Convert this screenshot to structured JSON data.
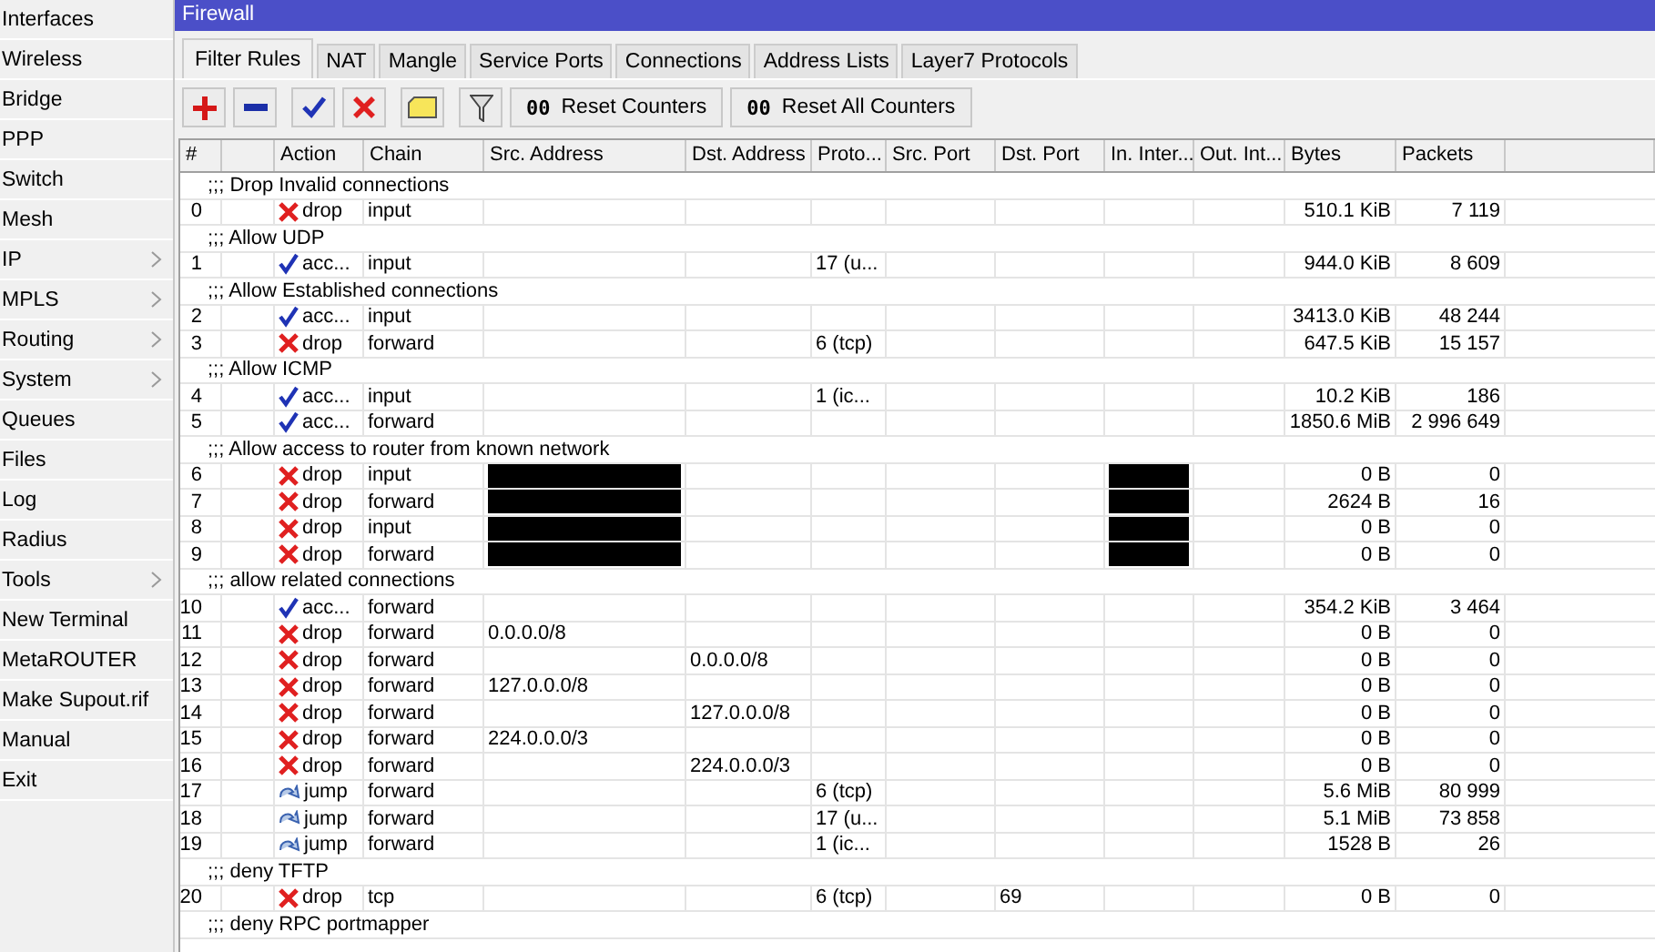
{
  "sidebar": {
    "items": [
      {
        "label": "Interfaces",
        "submenu": false
      },
      {
        "label": "Wireless",
        "submenu": false
      },
      {
        "label": "Bridge",
        "submenu": false
      },
      {
        "label": "PPP",
        "submenu": false
      },
      {
        "label": "Switch",
        "submenu": false
      },
      {
        "label": "Mesh",
        "submenu": false
      },
      {
        "label": "IP",
        "submenu": true
      },
      {
        "label": "MPLS",
        "submenu": true
      },
      {
        "label": "Routing",
        "submenu": true
      },
      {
        "label": "System",
        "submenu": true
      },
      {
        "label": "Queues",
        "submenu": false
      },
      {
        "label": "Files",
        "submenu": false
      },
      {
        "label": "Log",
        "submenu": false
      },
      {
        "label": "Radius",
        "submenu": false
      },
      {
        "label": "Tools",
        "submenu": true
      },
      {
        "label": "New Terminal",
        "submenu": false
      },
      {
        "label": "MetaROUTER",
        "submenu": false
      },
      {
        "label": "Make Supout.rif",
        "submenu": false
      },
      {
        "label": "Manual",
        "submenu": false
      },
      {
        "label": "Exit",
        "submenu": false
      }
    ]
  },
  "window": {
    "title": "Firewall"
  },
  "tabs": [
    {
      "label": "Filter Rules",
      "selected": true
    },
    {
      "label": "NAT",
      "selected": false
    },
    {
      "label": "Mangle",
      "selected": false
    },
    {
      "label": "Service Ports",
      "selected": false
    },
    {
      "label": "Connections",
      "selected": false
    },
    {
      "label": "Address Lists",
      "selected": false
    },
    {
      "label": "Layer7 Protocols",
      "selected": false
    }
  ],
  "toolbar": {
    "tools": [
      {
        "kind": "add"
      },
      {
        "kind": "remove"
      },
      {
        "kind": "enable"
      },
      {
        "kind": "disable"
      },
      {
        "kind": "comment"
      },
      {
        "kind": "filter"
      }
    ],
    "buttons": [
      {
        "icon_text": "00",
        "label": "Reset Counters"
      },
      {
        "icon_text": "00",
        "label": "Reset All Counters"
      }
    ]
  },
  "table": {
    "columns": [
      "#",
      "",
      "Action",
      "Chain",
      "Src. Address",
      "Dst. Address",
      "Proto...",
      "Src. Port",
      "Dst. Port",
      "In. Inter...",
      "Out. Int...",
      "Bytes",
      "Packets"
    ],
    "rows": [
      {
        "kind": "comment",
        "text": ";;; Drop Invalid connections"
      },
      {
        "kind": "drop",
        "num": "0",
        "action": "drop",
        "chain": "input",
        "src": "",
        "src_redacted": false,
        "dst": "",
        "proto": "",
        "src_port": "",
        "dst_port": "",
        "in_redacted": false,
        "bytes": "510.1 KiB",
        "packets": "7 119"
      },
      {
        "kind": "comment",
        "text": ";;; Allow UDP"
      },
      {
        "kind": "accept",
        "num": "1",
        "action": "acc...",
        "chain": "input",
        "src": "",
        "src_redacted": false,
        "dst": "",
        "proto": "17 (u...",
        "src_port": "",
        "dst_port": "",
        "in_redacted": false,
        "bytes": "944.0 KiB",
        "packets": "8 609"
      },
      {
        "kind": "comment",
        "text": ";;; Allow Established connections"
      },
      {
        "kind": "accept",
        "num": "2",
        "action": "acc...",
        "chain": "input",
        "src": "",
        "src_redacted": false,
        "dst": "",
        "proto": "",
        "src_port": "",
        "dst_port": "",
        "in_redacted": false,
        "bytes": "3413.0 KiB",
        "packets": "48 244"
      },
      {
        "kind": "drop",
        "num": "3",
        "action": "drop",
        "chain": "forward",
        "src": "",
        "src_redacted": false,
        "dst": "",
        "proto": "6 (tcp)",
        "src_port": "",
        "dst_port": "",
        "in_redacted": false,
        "bytes": "647.5 KiB",
        "packets": "15 157"
      },
      {
        "kind": "comment",
        "text": ";;; Allow ICMP"
      },
      {
        "kind": "accept",
        "num": "4",
        "action": "acc...",
        "chain": "input",
        "src": "",
        "src_redacted": false,
        "dst": "",
        "proto": "1 (ic...",
        "src_port": "",
        "dst_port": "",
        "in_redacted": false,
        "bytes": "10.2 KiB",
        "packets": "186"
      },
      {
        "kind": "accept",
        "num": "5",
        "action": "acc...",
        "chain": "forward",
        "src": "",
        "src_redacted": false,
        "dst": "",
        "proto": "",
        "src_port": "",
        "dst_port": "",
        "in_redacted": false,
        "bytes": "1850.6 MiB",
        "packets": "2 996 649"
      },
      {
        "kind": "comment",
        "text": ";;; Allow access to router from known network"
      },
      {
        "kind": "drop",
        "num": "6",
        "action": "drop",
        "chain": "input",
        "src": "",
        "src_redacted": true,
        "dst": "",
        "proto": "",
        "src_port": "",
        "dst_port": "",
        "in_redacted": true,
        "bytes": "0 B",
        "packets": "0"
      },
      {
        "kind": "drop",
        "num": "7",
        "action": "drop",
        "chain": "forward",
        "src": "",
        "src_redacted": true,
        "dst": "",
        "proto": "",
        "src_port": "",
        "dst_port": "",
        "in_redacted": true,
        "bytes": "2624 B",
        "packets": "16"
      },
      {
        "kind": "drop",
        "num": "8",
        "action": "drop",
        "chain": "input",
        "src": "",
        "src_redacted": true,
        "dst": "",
        "proto": "",
        "src_port": "",
        "dst_port": "",
        "in_redacted": true,
        "bytes": "0 B",
        "packets": "0"
      },
      {
        "kind": "drop",
        "num": "9",
        "action": "drop",
        "chain": "forward",
        "src": "",
        "src_redacted": true,
        "dst": "",
        "proto": "",
        "src_port": "",
        "dst_port": "",
        "in_redacted": true,
        "bytes": "0 B",
        "packets": "0"
      },
      {
        "kind": "comment",
        "text": ";;; allow related connections"
      },
      {
        "kind": "accept",
        "num": "10",
        "action": "acc...",
        "chain": "forward",
        "src": "",
        "src_redacted": false,
        "dst": "",
        "proto": "",
        "src_port": "",
        "dst_port": "",
        "in_redacted": false,
        "bytes": "354.2 KiB",
        "packets": "3 464"
      },
      {
        "kind": "drop",
        "num": "11",
        "action": "drop",
        "chain": "forward",
        "src": "0.0.0.0/8",
        "src_redacted": false,
        "dst": "",
        "proto": "",
        "src_port": "",
        "dst_port": "",
        "in_redacted": false,
        "bytes": "0 B",
        "packets": "0"
      },
      {
        "kind": "drop",
        "num": "12",
        "action": "drop",
        "chain": "forward",
        "src": "",
        "src_redacted": false,
        "dst": "0.0.0.0/8",
        "proto": "",
        "src_port": "",
        "dst_port": "",
        "in_redacted": false,
        "bytes": "0 B",
        "packets": "0"
      },
      {
        "kind": "drop",
        "num": "13",
        "action": "drop",
        "chain": "forward",
        "src": "127.0.0.0/8",
        "src_redacted": false,
        "dst": "",
        "proto": "",
        "src_port": "",
        "dst_port": "",
        "in_redacted": false,
        "bytes": "0 B",
        "packets": "0"
      },
      {
        "kind": "drop",
        "num": "14",
        "action": "drop",
        "chain": "forward",
        "src": "",
        "src_redacted": false,
        "dst": "127.0.0.0/8",
        "proto": "",
        "src_port": "",
        "dst_port": "",
        "in_redacted": false,
        "bytes": "0 B",
        "packets": "0"
      },
      {
        "kind": "drop",
        "num": "15",
        "action": "drop",
        "chain": "forward",
        "src": "224.0.0.0/3",
        "src_redacted": false,
        "dst": "",
        "proto": "",
        "src_port": "",
        "dst_port": "",
        "in_redacted": false,
        "bytes": "0 B",
        "packets": "0"
      },
      {
        "kind": "drop",
        "num": "16",
        "action": "drop",
        "chain": "forward",
        "src": "",
        "src_redacted": false,
        "dst": "224.0.0.0/3",
        "proto": "",
        "src_port": "",
        "dst_port": "",
        "in_redacted": false,
        "bytes": "0 B",
        "packets": "0"
      },
      {
        "kind": "jump",
        "num": "17",
        "action": "jump",
        "chain": "forward",
        "src": "",
        "src_redacted": false,
        "dst": "",
        "proto": "6 (tcp)",
        "src_port": "",
        "dst_port": "",
        "in_redacted": false,
        "bytes": "5.6 MiB",
        "packets": "80 999"
      },
      {
        "kind": "jump",
        "num": "18",
        "action": "jump",
        "chain": "forward",
        "src": "",
        "src_redacted": false,
        "dst": "",
        "proto": "17 (u...",
        "src_port": "",
        "dst_port": "",
        "in_redacted": false,
        "bytes": "5.1 MiB",
        "packets": "73 858"
      },
      {
        "kind": "jump",
        "num": "19",
        "action": "jump",
        "chain": "forward",
        "src": "",
        "src_redacted": false,
        "dst": "",
        "proto": "1 (ic...",
        "src_port": "",
        "dst_port": "",
        "in_redacted": false,
        "bytes": "1528 B",
        "packets": "26"
      },
      {
        "kind": "comment",
        "text": ";;; deny TFTP"
      },
      {
        "kind": "drop",
        "num": "20",
        "action": "drop",
        "chain": "tcp",
        "src": "",
        "src_redacted": false,
        "dst": "",
        "proto": "6 (tcp)",
        "src_port": "",
        "dst_port": "69",
        "in_redacted": false,
        "bytes": "0 B",
        "packets": "0"
      },
      {
        "kind": "comment",
        "text": ";;; deny RPC portmapper"
      }
    ]
  }
}
